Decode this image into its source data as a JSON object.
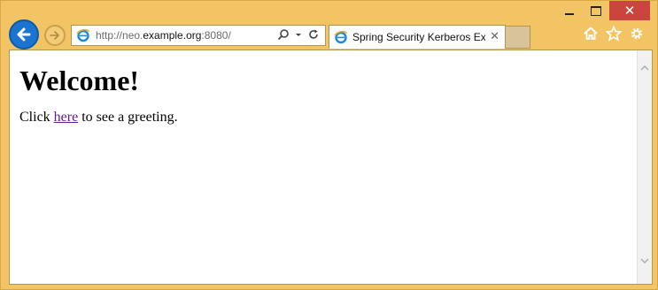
{
  "window": {
    "minimize_glyph": "",
    "maximize_glyph": "",
    "close_glyph": "✕"
  },
  "nav": {
    "back_icon": "back-arrow-icon",
    "forward_icon": "forward-arrow-icon"
  },
  "address_bar": {
    "url_prefix": "http://neo.",
    "url_host": "example.org",
    "url_suffix": ":8080/",
    "search_icon": "search-icon",
    "dropdown_icon": "chevron-down-icon",
    "refresh_icon": "refresh-icon"
  },
  "tab": {
    "title": "Spring Security Kerberos Ex...",
    "close_glyph": "✕"
  },
  "toolbar": {
    "home_icon": "home-icon",
    "favorites_icon": "star-icon",
    "settings_icon": "gear-icon"
  },
  "page": {
    "heading": "Welcome!",
    "text_before": "Click ",
    "link_text": "here",
    "text_after": " to see a greeting."
  },
  "colors": {
    "frame": "#f2c464",
    "link": "#6a1b8f",
    "close_button": "#c9453e",
    "back_button": "#1b74cf"
  }
}
